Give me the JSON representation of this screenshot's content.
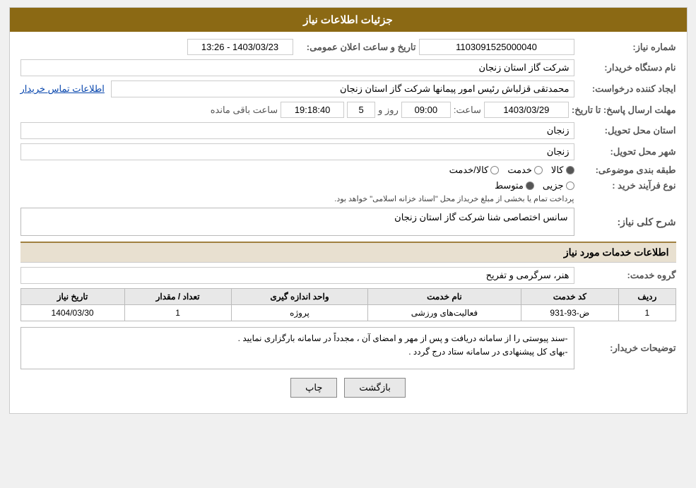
{
  "page": {
    "title": "جزئیات اطلاعات نیاز"
  },
  "header": {
    "need_number_label": "شماره نیاز:",
    "need_number_value": "1103091525000040",
    "announcement_date_label": "تاریخ و ساعت اعلان عمومی:",
    "announcement_date_value": "1403/03/23 - 13:26",
    "buyer_org_label": "نام دستگاه خریدار:",
    "buyer_org_value": "شرکت گاز استان زنجان",
    "creator_label": "ایجاد کننده درخواست:",
    "creator_name": "محمدتقی قزلباش رئیس امور پیمانها شرکت گاز استان زنجان",
    "creator_link": "اطلاعات تماس خریدار",
    "deadline_label": "مهلت ارسال پاسخ: تا تاریخ:",
    "deadline_date": "1403/03/29",
    "deadline_time_label": "ساعت:",
    "deadline_time": "09:00",
    "deadline_day_label": "روز و",
    "deadline_days": "5",
    "deadline_remaining_label": "ساعت باقی مانده",
    "deadline_remaining": "19:18:40",
    "province_label": "استان محل تحویل:",
    "province_value": "زنجان",
    "city_label": "شهر محل تحویل:",
    "city_value": "زنجان",
    "category_label": "طبقه بندی موضوعی:",
    "category_options": [
      {
        "id": "kala",
        "label": "کالا",
        "selected": true
      },
      {
        "id": "khadamat",
        "label": "خدمت",
        "selected": false
      },
      {
        "id": "kala_khadamat",
        "label": "کالا/خدمت",
        "selected": false
      }
    ],
    "process_label": "نوع فرآیند خرید :",
    "process_options": [
      {
        "id": "jozvi",
        "label": "جزیی",
        "selected": false
      },
      {
        "id": "motavaset",
        "label": "متوسط",
        "selected": true
      }
    ],
    "process_desc": "پرداخت تمام یا بخشی از مبلغ خریداز محل \"اسناد خزانه اسلامی\" خواهد بود.",
    "general_desc_label": "شرح کلی نیاز:",
    "general_desc_value": "سانس اختصاصی شنا شرکت گاز استان زنجان"
  },
  "services_section": {
    "title": "اطلاعات خدمات مورد نیاز",
    "service_group_label": "گروه خدمت:",
    "service_group_value": "هنر، سرگرمی و تفریح",
    "table": {
      "columns": [
        "ردیف",
        "کد خدمت",
        "نام خدمت",
        "واحد اندازه گیری",
        "تعداد / مقدار",
        "تاریخ نیاز"
      ],
      "rows": [
        {
          "row": "1",
          "code": "ض-93-931",
          "name": "فعالیت‌های ورزشی",
          "unit": "پروژه",
          "quantity": "1",
          "date": "1404/03/30"
        }
      ]
    }
  },
  "remarks_section": {
    "label": "توضیحات خریدار:",
    "line1": "-سند پیوستی را از سامانه دریافت و پس از مهر و امضای آن ، مجدداً در سامانه بارگزاری نمایید .",
    "line2": "-بهای کل پیشنهادی در سامانه ستاد درج گردد ."
  },
  "buttons": {
    "print_label": "چاپ",
    "back_label": "بازگشت"
  }
}
